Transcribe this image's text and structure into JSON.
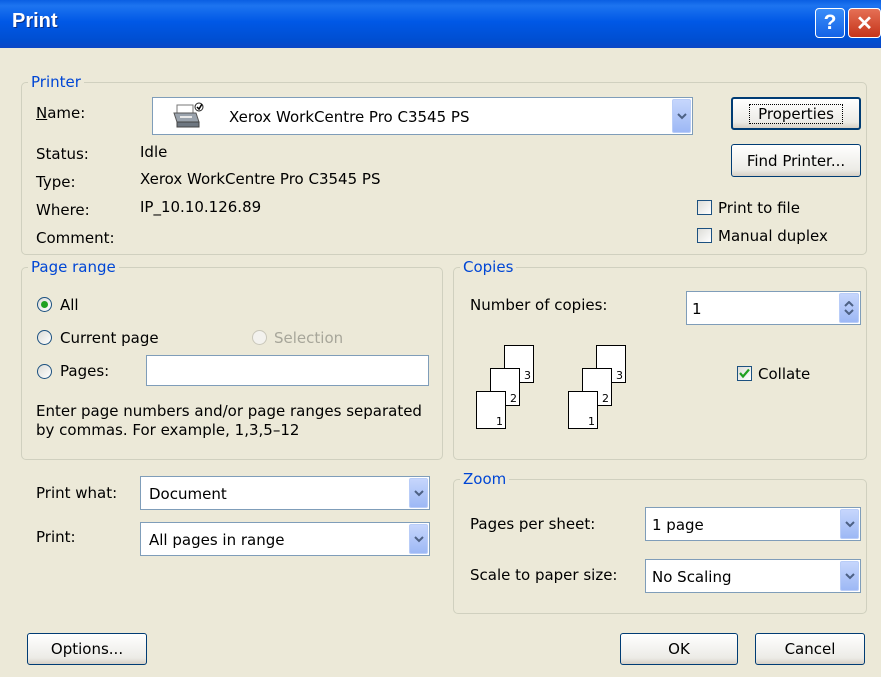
{
  "window": {
    "title": "Print",
    "help_label": "?",
    "close_label": "✕"
  },
  "printer": {
    "legend": "Printer",
    "name_label": "Name:",
    "name_value": "Xerox WorkCentre Pro C3545 PS",
    "properties_label": "Properties",
    "find_printer_label": "Find Printer...",
    "status_label": "Status:",
    "status_value": "Idle",
    "type_label": "Type:",
    "type_value": "Xerox WorkCentre Pro C3545 PS",
    "where_label": "Where:",
    "where_value": "IP_10.10.126.89",
    "comment_label": "Comment:",
    "comment_value": "",
    "print_to_file_label": "Print to file",
    "print_to_file_checked": false,
    "manual_duplex_label": "Manual duplex",
    "manual_duplex_checked": false
  },
  "page_range": {
    "legend": "Page range",
    "all_label": "All",
    "current_page_label": "Current page",
    "selection_label": "Selection",
    "pages_label": "Pages:",
    "pages_value": "",
    "selected": "All",
    "hint": "Enter page numbers and/or page ranges separated by commas.  For example, 1,3,5–12"
  },
  "copies": {
    "legend": "Copies",
    "number_label": "Number of copies:",
    "number_value": "1",
    "collate_label": "Collate",
    "collate_checked": true,
    "page_numbers": [
      "1",
      "2",
      "3"
    ]
  },
  "print_what": {
    "label": "Print what:",
    "value": "Document"
  },
  "print": {
    "label": "Print:",
    "value": "All pages in range"
  },
  "zoom": {
    "legend": "Zoom",
    "pages_per_sheet_label": "Pages per sheet:",
    "pages_per_sheet_value": "1 page",
    "scale_label": "Scale to paper size:",
    "scale_value": "No Scaling"
  },
  "buttons": {
    "options": "Options...",
    "ok": "OK",
    "cancel": "Cancel"
  },
  "icons": {
    "printer": "printer-icon",
    "dropdown": "chevron-down-icon",
    "spin": "spin-arrows-icon",
    "check": "check-icon"
  },
  "colors": {
    "titlebar": "#0058e6",
    "group_legend": "#0046d5",
    "dialog_bg": "#ece9d8"
  }
}
